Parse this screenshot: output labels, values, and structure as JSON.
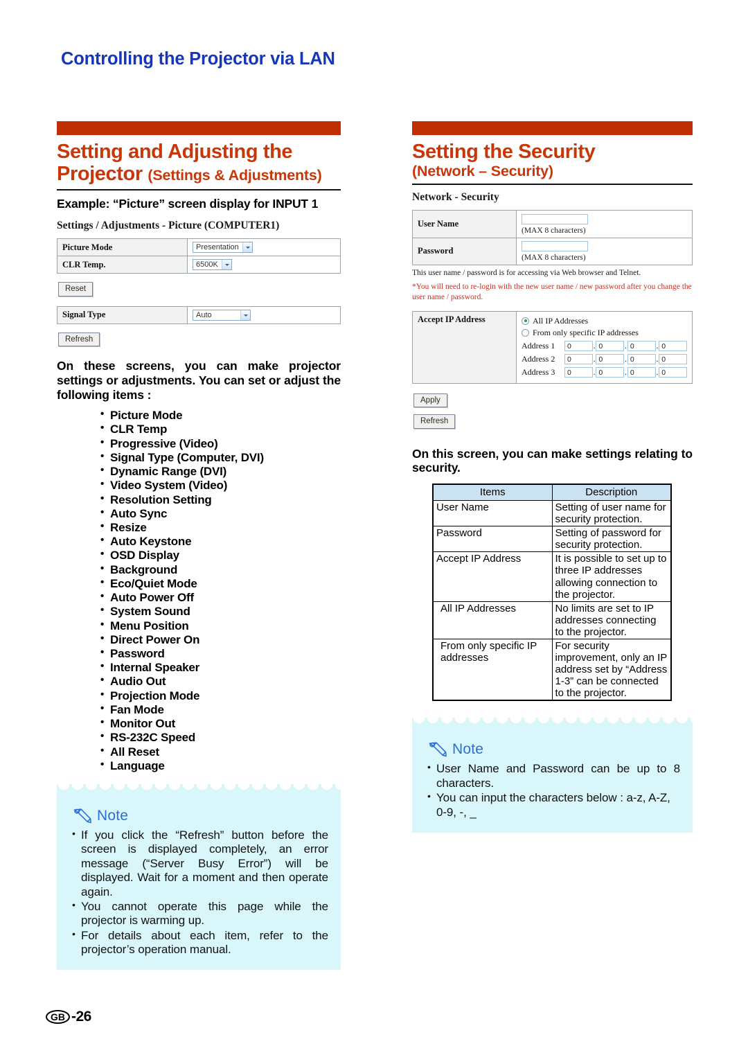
{
  "page": {
    "running_title": "Controlling the Projector via LAN",
    "footer_region": "GB",
    "footer_page": "-26",
    "accent_orange": "#C02E06",
    "accent_orange_text": "#C93608",
    "accent_blue": "#1736B8",
    "note_bg": "#D9F6FA",
    "note_label_color": "#2B6FD6",
    "table_header_bg": "#CBE2F2"
  },
  "left": {
    "heading_line1": "Setting and Adjusting the",
    "heading_line2_bold": "Projector ",
    "heading_line2_small": "(Settings & Adjustments)",
    "subhead": "Example: “Picture” screen display for INPUT 1",
    "screenshot": {
      "title": "Settings / Adjustments - Picture (COMPUTER1)",
      "rows": [
        {
          "label": "Picture Mode",
          "value": "Presentation"
        },
        {
          "label": "CLR Temp.",
          "value": "6500K"
        }
      ],
      "reset_button": "Reset",
      "signal_row": {
        "label": "Signal Type",
        "value": "Auto"
      },
      "refresh_button": "Refresh"
    },
    "intro": "On these screens, you can make projector settings or adjustments. You can set or adjust the following items :",
    "items": [
      "Picture Mode",
      "CLR Temp",
      "Progressive (Video)",
      "Signal Type (Computer, DVI)",
      "Dynamic Range (DVI)",
      "Video System (Video)",
      "Resolution Setting",
      "Auto Sync",
      "Resize",
      "Auto Keystone",
      "OSD Display",
      "Background",
      "Eco/Quiet Mode",
      "Auto Power Off",
      "System Sound",
      "Menu Position",
      "Direct Power On",
      "Password",
      "Internal Speaker",
      "Audio Out",
      "Projection Mode",
      "Fan Mode",
      "Monitor Out",
      "RS-232C Speed",
      "All Reset",
      "Language"
    ],
    "note": {
      "label": "Note",
      "bullets": [
        "If you click the “Refresh” button before the screen is displayed completely, an error message (“Server Busy Error”) will be displayed. Wait for a moment and then operate again.",
        "You cannot operate this page while the projector is warming up.",
        "For details about each item, refer to the projector’s operation manual."
      ]
    }
  },
  "right": {
    "heading_line1": "Setting the Security",
    "heading_line2": "(Network – Security)",
    "screenshot": {
      "title": "Network - Security",
      "user_name_label": "User Name",
      "user_name_value": "",
      "user_name_hint": "(MAX 8 characters)",
      "password_label": "Password",
      "password_value": "",
      "password_hint": "(MAX 8 characters)",
      "info_line": "This user name / password is for accessing via Web browser and Telnet.",
      "warn_line": "*You will need to re-login with the new user name / new password after you change the user name / password.",
      "accept_label": "Accept IP Address",
      "radio_all": "All IP Addresses",
      "radio_specific": "From only specific IP addresses",
      "selected_radio": "All IP Addresses",
      "addresses": [
        {
          "label": "Address 1",
          "octets": [
            "0",
            "0",
            "0",
            "0"
          ]
        },
        {
          "label": "Address 2",
          "octets": [
            "0",
            "0",
            "0",
            "0"
          ]
        },
        {
          "label": "Address 3",
          "octets": [
            "0",
            "0",
            "0",
            "0"
          ]
        }
      ],
      "apply_button": "Apply",
      "refresh_button": "Refresh"
    },
    "intro": "On this screen, you can make settings relating to security.",
    "table": {
      "headers": [
        "Items",
        "Description"
      ],
      "rows": [
        {
          "item": "User Name",
          "desc": "Setting of user name for security protection.",
          "indent": false
        },
        {
          "item": "Password",
          "desc": "Setting of password for security protection.",
          "indent": false
        },
        {
          "item": "Accept IP Address",
          "desc": "It is possible to set up to three IP addresses allowing connection to the projector.",
          "indent": false
        },
        {
          "item": "All IP Addresses",
          "desc": "No limits are set to IP addresses connecting to the projector.",
          "indent": true
        },
        {
          "item": "From only specific IP addresses",
          "desc": "For security improvement, only an IP address set by “Address 1-3” can be connected to the projector.",
          "indent": true
        }
      ]
    },
    "note": {
      "label": "Note",
      "bullets": [
        "User Name and Password can be up to 8 characters.",
        "You can input the characters below : a-z, A-Z, 0-9, -, _"
      ]
    }
  }
}
